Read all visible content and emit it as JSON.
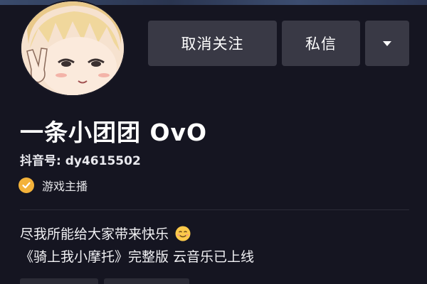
{
  "header": {
    "avatar_icon": "anime-avatar-icon"
  },
  "actions": {
    "unfollow_label": "取消关注",
    "message_label": "私信",
    "more_icon": "caret-down-icon"
  },
  "profile": {
    "nickname": "一条小团团 OvO",
    "account_id": "抖音号: dy4615502",
    "verify_icon": "check-badge-icon",
    "verify_label": "游戏主播"
  },
  "bio": {
    "line1": "尽我所能给大家带来快乐",
    "line1_emoji": "smiling-face-icon",
    "line2": "《骑上我小摩托》完整版 云音乐已上线"
  },
  "colors": {
    "background": "#151521",
    "button_bg": "#393945",
    "verify_badge": "#f3b23a"
  }
}
